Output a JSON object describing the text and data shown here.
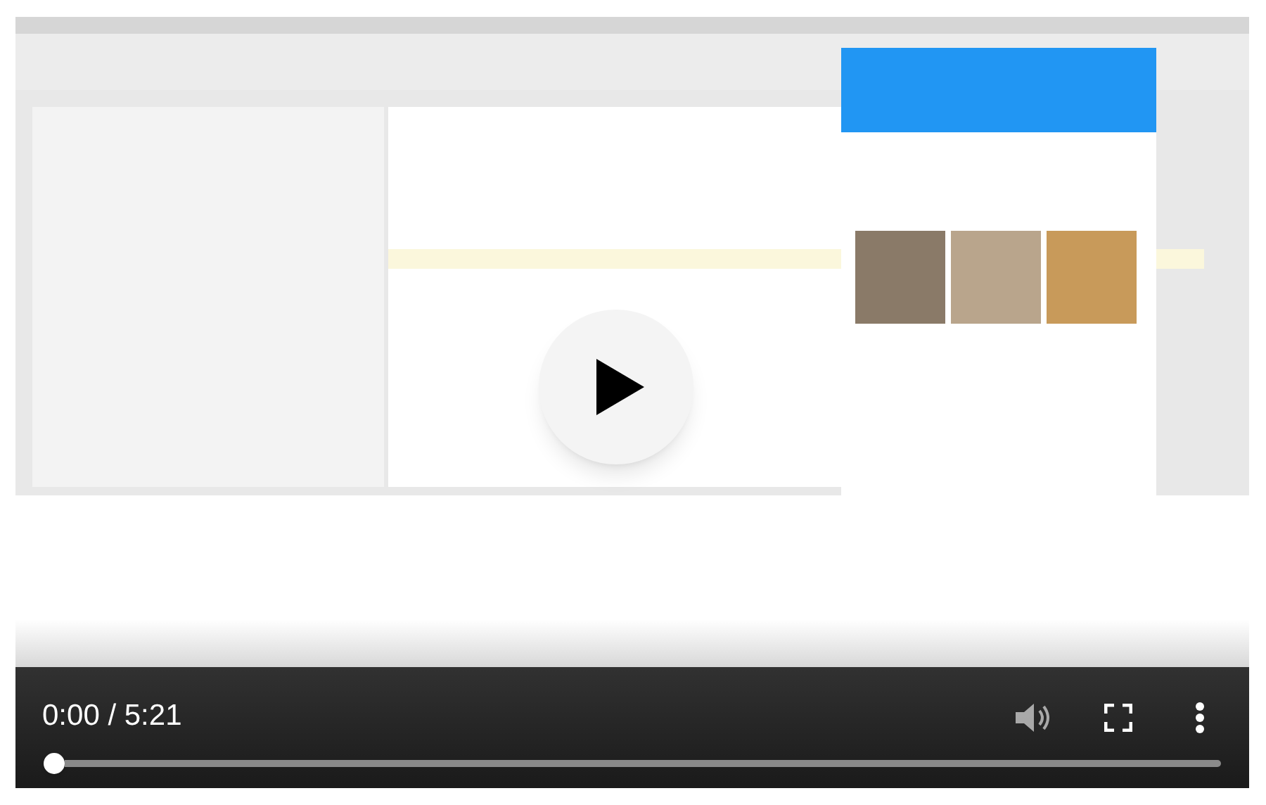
{
  "player": {
    "playing": false,
    "time": "0:00 / 5:21",
    "progress": {
      "level": 0
    }
  }
}
